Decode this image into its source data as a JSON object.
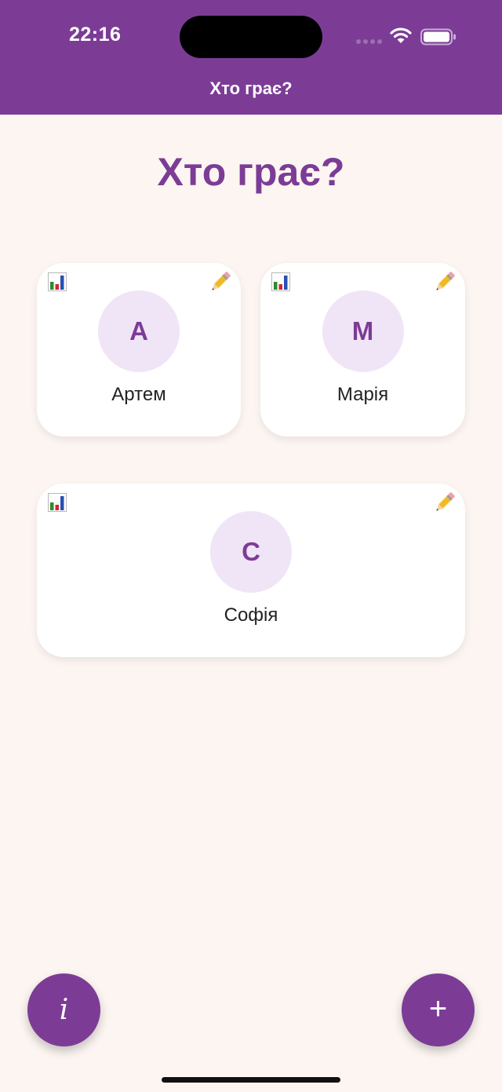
{
  "status_bar": {
    "time": "22:16"
  },
  "nav": {
    "title": "Хто грає?"
  },
  "page": {
    "title": "Хто грає?"
  },
  "players": [
    {
      "initial": "А",
      "name": "Артем",
      "stats_icon": "bar-chart-icon",
      "edit_icon": "pencil-icon"
    },
    {
      "initial": "М",
      "name": "Марія",
      "stats_icon": "bar-chart-icon",
      "edit_icon": "pencil-icon"
    },
    {
      "initial": "С",
      "name": "Софія",
      "stats_icon": "bar-chart-icon",
      "edit_icon": "pencil-icon"
    }
  ],
  "fab": {
    "info_label": "i",
    "add_label": "+"
  },
  "colors": {
    "accent": "#7C3C96",
    "background": "#FCF5F1",
    "avatar_bg": "#F0E5F6",
    "card_bg": "#FFFFFF"
  }
}
